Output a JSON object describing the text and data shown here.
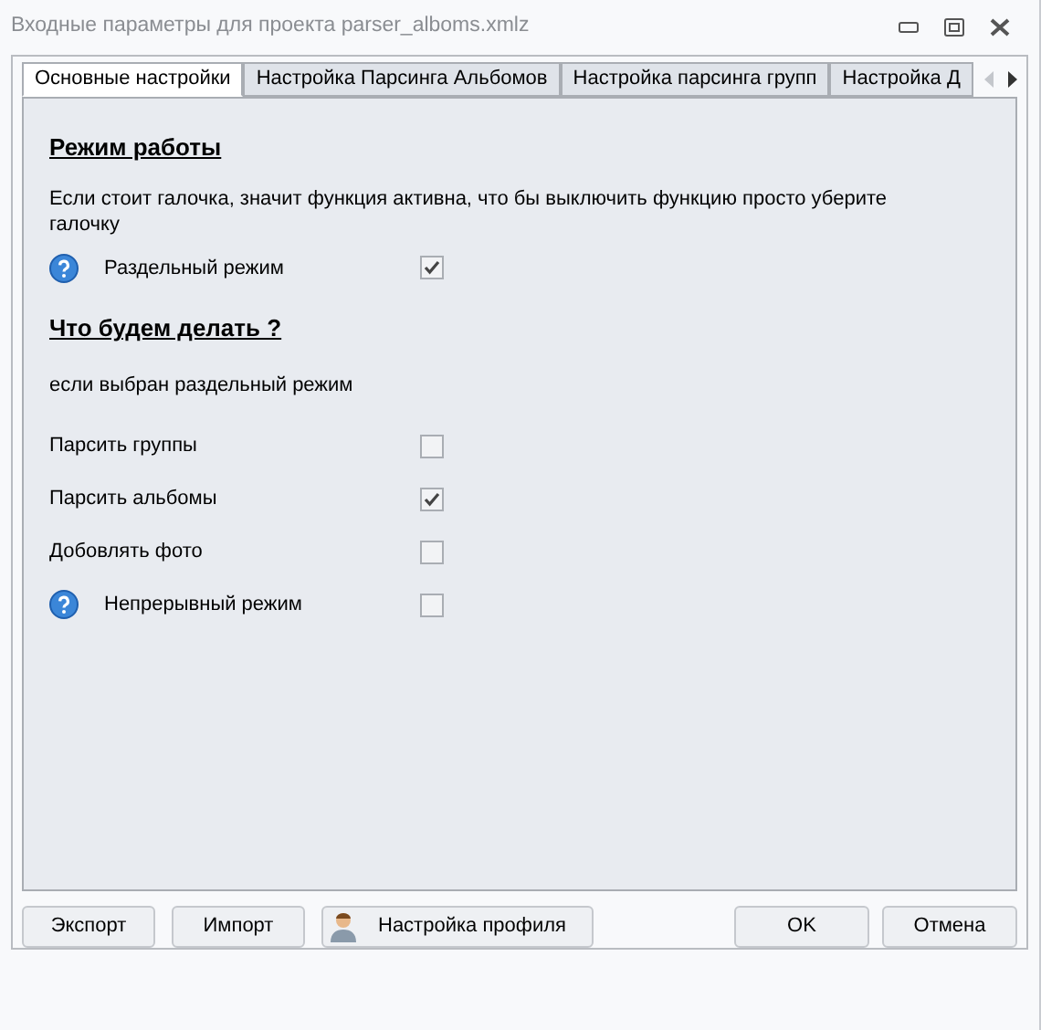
{
  "window": {
    "title": "Входные параметры для проекта parser_alboms.xmlz"
  },
  "tabs": [
    {
      "label": "Основные настройки",
      "selected": true
    },
    {
      "label": "Настройка Парсинга  Альбомов",
      "selected": false
    },
    {
      "label": "Настройка парсинга групп",
      "selected": false
    },
    {
      "label": "Настройка Д",
      "selected": false
    }
  ],
  "sections": [
    {
      "heading": "Режим работы",
      "description": "Если стоит галочка, значит функция активна, что бы выключить функцию просто уберите галочку",
      "options": [
        {
          "label": "Раздельный режим",
          "help": true,
          "checked": true
        }
      ]
    },
    {
      "heading": "Что будем делать ?",
      "description": "если выбран раздельный режим",
      "options": [
        {
          "label": "Парсить группы",
          "help": false,
          "checked": false
        },
        {
          "label": "Парсить альбомы",
          "help": false,
          "checked": true
        },
        {
          "label": "Добовлять фото",
          "help": false,
          "checked": false
        },
        {
          "label": "Непрерывный режим",
          "help": true,
          "checked": false
        }
      ]
    }
  ],
  "buttons_left": [
    {
      "label": "Экспорт",
      "kind": "plain"
    },
    {
      "label": "Импорт",
      "kind": "plain"
    },
    {
      "label": "Настройка профиля",
      "kind": "profile"
    }
  ],
  "buttons_right": [
    {
      "label": "OK"
    },
    {
      "label": "Отмена"
    }
  ]
}
